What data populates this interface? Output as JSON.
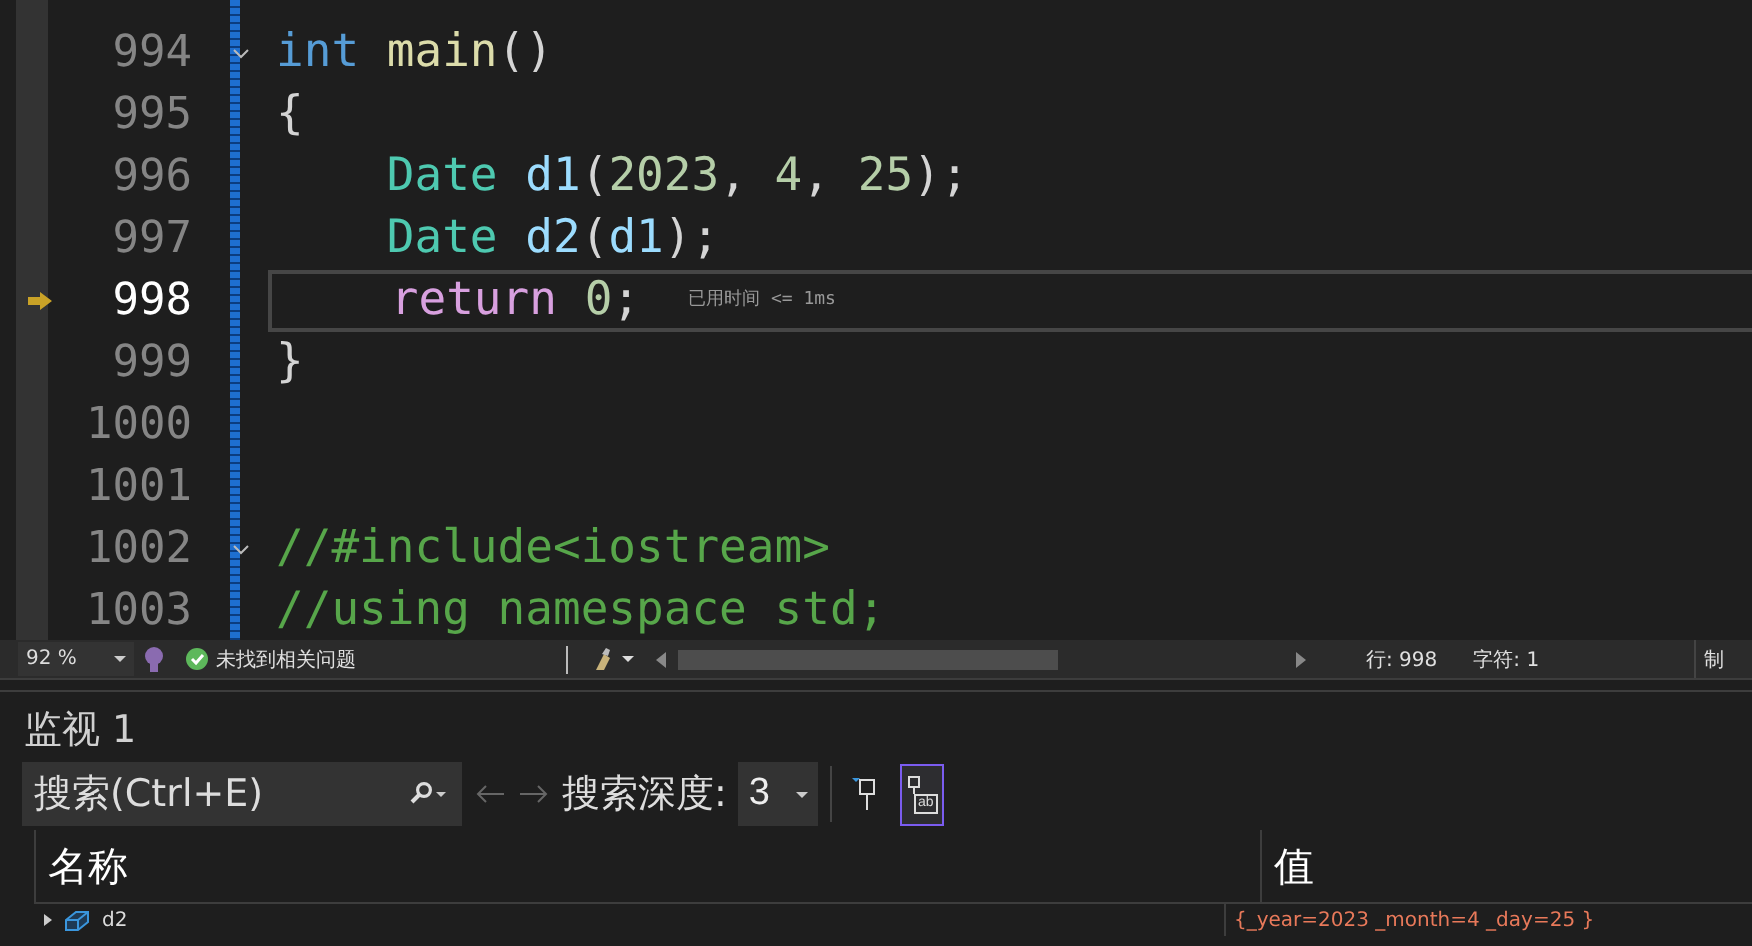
{
  "editor": {
    "lines": [
      {
        "number": "994",
        "current": false,
        "fold": true,
        "indented": false,
        "tokens": [
          {
            "kind": "keyword",
            "text": "int "
          },
          {
            "kind": "func",
            "text": "main"
          },
          {
            "kind": "punct",
            "text": "()"
          }
        ]
      },
      {
        "number": "995",
        "current": false,
        "fold": false,
        "indented": false,
        "tokens": [
          {
            "kind": "punct",
            "text": "{"
          }
        ]
      },
      {
        "number": "996",
        "current": false,
        "fold": false,
        "indented": true,
        "tokens": [
          {
            "kind": "type",
            "text": "Date "
          },
          {
            "kind": "variable",
            "text": "d1"
          },
          {
            "kind": "punct",
            "text": "("
          },
          {
            "kind": "number",
            "text": "2023"
          },
          {
            "kind": "punct",
            "text": ", "
          },
          {
            "kind": "number",
            "text": "4"
          },
          {
            "kind": "punct",
            "text": ", "
          },
          {
            "kind": "number",
            "text": "25"
          },
          {
            "kind": "punct",
            "text": ");"
          }
        ]
      },
      {
        "number": "997",
        "current": false,
        "fold": false,
        "indented": true,
        "tokens": [
          {
            "kind": "type",
            "text": "Date "
          },
          {
            "kind": "variable",
            "text": "d2"
          },
          {
            "kind": "punct",
            "text": "("
          },
          {
            "kind": "variable",
            "text": "d1"
          },
          {
            "kind": "punct",
            "text": ");"
          }
        ]
      },
      {
        "number": "998",
        "current": true,
        "fold": false,
        "indented": true,
        "hint": "已用时间 <= 1ms",
        "tokens": [
          {
            "kind": "control",
            "text": "return "
          },
          {
            "kind": "number",
            "text": "0"
          },
          {
            "kind": "punct",
            "text": ";"
          }
        ]
      },
      {
        "number": "999",
        "current": false,
        "fold": false,
        "indented": false,
        "tokens": [
          {
            "kind": "punct",
            "text": "}"
          }
        ]
      },
      {
        "number": "1000",
        "current": false,
        "fold": false
      },
      {
        "number": "1001",
        "current": false,
        "fold": false
      },
      {
        "number": "1002",
        "current": false,
        "fold": true,
        "indented": false,
        "tokens": [
          {
            "kind": "comment",
            "text": "//#include<iostream>"
          }
        ]
      },
      {
        "number": "1003",
        "current": false,
        "fold": false,
        "indented": false,
        "tokens": [
          {
            "kind": "comment",
            "text": "//using namespace std;"
          }
        ]
      }
    ]
  },
  "status_bar": {
    "zoom": "92 %",
    "issues": "未找到相关问题",
    "line": "行: 998",
    "char": "字符: 1",
    "tab": "制"
  },
  "watch": {
    "title": "监视 1",
    "search": {
      "placeholder": "搜索(Ctrl+E)"
    },
    "depth_label": "搜索深度:",
    "depth": "3",
    "toggles": [
      {
        "selected": false
      },
      {
        "selected": true,
        "label": "ab"
      }
    ],
    "columns": [
      "名称",
      "值"
    ],
    "rows": [
      {
        "name": "d2",
        "value": "{_year=2023 _month=4 _day=25 }",
        "changed": true
      }
    ]
  }
}
